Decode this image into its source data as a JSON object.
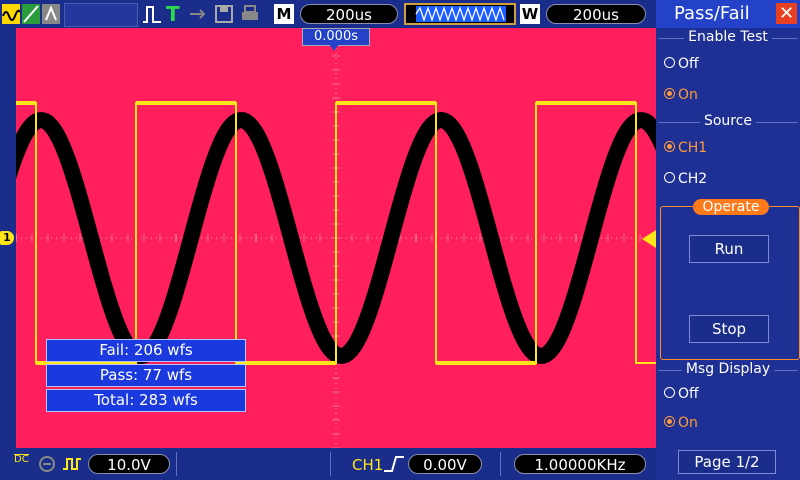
{
  "top_bar": {
    "mode_label": "M",
    "main_timebase": "200us",
    "window_label": "W",
    "window_timebase": "200us",
    "trigger_time": "0.000s"
  },
  "channel_marker": "1",
  "stats": {
    "fail": "Fail: 206 wfs",
    "pass": "Pass: 77 wfs",
    "total": "Total: 283 wfs"
  },
  "bottom_bar": {
    "coupling": "DC",
    "ch1_scale": "10.0V",
    "trigger_source": "CH1",
    "trigger_level": "0.00V",
    "frequency": "1.00000KHz"
  },
  "panel": {
    "title": "Pass/Fail",
    "enable_test": {
      "label": "Enable Test",
      "options": [
        "Off",
        "On"
      ],
      "selected": "On"
    },
    "source": {
      "label": "Source",
      "options": [
        "CH1",
        "CH2"
      ],
      "selected": "CH1"
    },
    "operate": {
      "label": "Operate",
      "run_label": "Run",
      "stop_label": "Stop"
    },
    "msg_display": {
      "label": "Msg Display",
      "options": [
        "Off",
        "On"
      ],
      "selected": "On"
    },
    "page_label": "Page 1/2"
  },
  "colors": {
    "screen_bg": "#ff1f5c",
    "trace_square": "#ffe61a",
    "trace_sine": "#000000",
    "selected_option": "#ff9a3a",
    "bar_bg": "#1a2d8a"
  }
}
